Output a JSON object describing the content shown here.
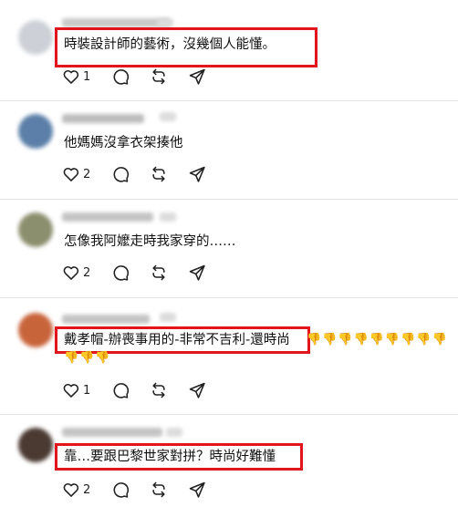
{
  "comments": [
    {
      "text": "時裝設計師的藝術，沒幾個人能懂。",
      "likes": "1"
    },
    {
      "text": "他媽媽沒拿衣架揍他",
      "likes": "2"
    },
    {
      "text": "怎像我阿嬤走時我家穿的……",
      "likes": "2"
    },
    {
      "text": "戴孝帽-辦喪事用的-非常不吉利-還時尚",
      "likes": "1",
      "emoji_row1": "👎👎👎👎👎👎👎👎👎",
      "emoji_row2": "👎👎👎"
    },
    {
      "text": "靠…要跟巴黎世家對拼？時尚好難懂",
      "likes": "2"
    }
  ],
  "icons": [
    "heart-icon",
    "comment-icon",
    "repost-icon",
    "share-icon"
  ],
  "colors": {
    "highlight": "#e3141b",
    "divider": "#e3e3e3",
    "emoji": "#f2b705"
  }
}
